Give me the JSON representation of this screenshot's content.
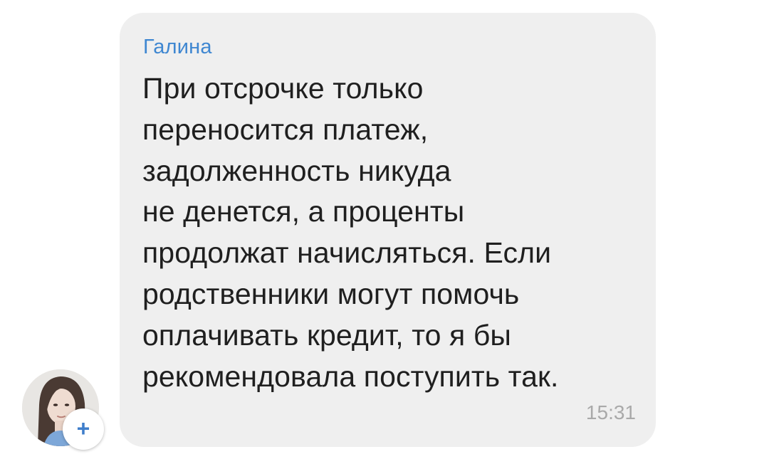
{
  "message": {
    "sender_name": "Галина",
    "text": "При отсрочке только\nпереносится платеж,\nзадолженность никуда\nне денется, а проценты\nпродолжат начисляться. Если\nродственники могут помочь\nоплачивать кредит, то я бы\nрекомендовала поступить так.",
    "time": "15:31"
  },
  "avatar": {
    "add_icon": "+"
  },
  "colors": {
    "bubble_bg": "#efefef",
    "sender": "#3f87d1",
    "text": "#1f1f1f",
    "time": "#a9a9a9",
    "accent": "#3f7ecb"
  }
}
